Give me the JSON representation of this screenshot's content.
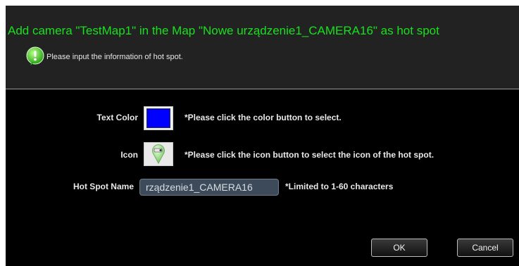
{
  "dialog": {
    "title": "Add camera \"TestMap1\" in the Map \"Nowe urządzenie1_CAMERA16\"  as hot spot",
    "subtitle": "Please input the information of hot spot.",
    "info_icon": "info-bubble-icon"
  },
  "form": {
    "text_color": {
      "label": "Text Color",
      "value_color": "#0000ff",
      "hint": "*Please click the color button to select."
    },
    "icon": {
      "label": "Icon",
      "icon_name": "map-pin-icon",
      "hint": "*Please click the icon button to select the icon of the hot spot."
    },
    "hot_spot_name": {
      "label": "Hot Spot Name",
      "value": "rządzenie1_CAMERA16",
      "hint": "*Limited to 1-60 characters"
    }
  },
  "buttons": {
    "ok": "OK",
    "cancel": "Cancel"
  },
  "colors": {
    "title": "#19e01e",
    "background": "#000000",
    "header": "#222222"
  }
}
